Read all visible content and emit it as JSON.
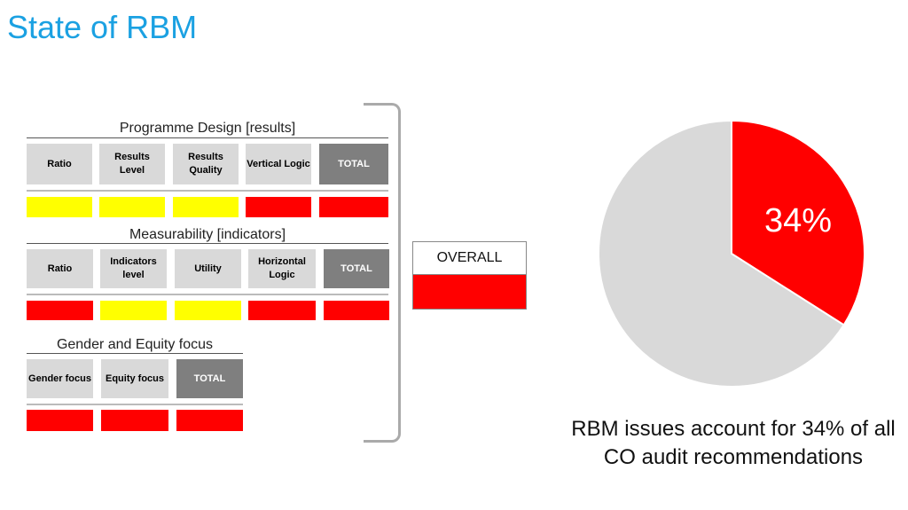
{
  "title": "State of RBM",
  "colors": {
    "red": "#ff0000",
    "yellow": "#ffff00",
    "gray": "#d9d9d9",
    "total": "#7f7f7f",
    "title": "#1ba1e2"
  },
  "sections": [
    {
      "title": "Programme Design [results]",
      "headers": [
        "Ratio",
        "Results Level",
        "Results Quality",
        "Vertical Logic",
        "TOTAL"
      ],
      "statuses": [
        "yellow",
        "yellow",
        "yellow",
        "red",
        "red"
      ]
    },
    {
      "title": "Measurability [indicators]",
      "headers": [
        "Ratio",
        "Indicators level",
        "Utility",
        "Horizontal Logic",
        "TOTAL"
      ],
      "statuses": [
        "red",
        "yellow",
        "yellow",
        "red",
        "red"
      ]
    },
    {
      "title": "Gender and Equity focus",
      "headers": [
        "Gender focus",
        "Equity focus",
        "TOTAL"
      ],
      "statuses": [
        "red",
        "red",
        "red"
      ]
    }
  ],
  "overall": {
    "label": "OVERALL",
    "status": "red"
  },
  "chart_data": {
    "type": "pie",
    "slices": [
      {
        "value": 34,
        "color": "#ff0000"
      },
      {
        "value": 66,
        "color": "#d9d9d9"
      }
    ],
    "data_label": "34%"
  },
  "caption": "RBM issues account for 34% of all\nCO audit recommendations"
}
